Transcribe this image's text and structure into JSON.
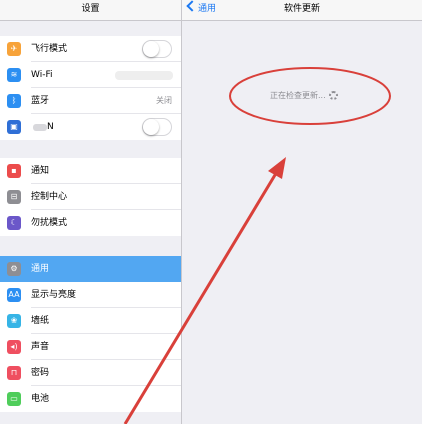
{
  "left_panel": {
    "title": "设置",
    "groups": [
      [
        {
          "label": "飞行模式",
          "icon": "airplane-icon",
          "color": "#f7a33a",
          "glyph": "✈",
          "control": "toggle"
        },
        {
          "label": "Wi-Fi",
          "icon": "wifi-icon",
          "color": "#2c8ff2",
          "glyph": "≋",
          "control": "blurred"
        },
        {
          "label": "蓝牙",
          "icon": "bluetooth-icon",
          "color": "#2c8ff2",
          "glyph": "ᛒ",
          "value": "关闭"
        },
        {
          "label": "N",
          "icon": "vpn-icon",
          "color": "#2f6fd6",
          "glyph": "▣",
          "control": "toggle",
          "blurred_prefix": true
        }
      ],
      [
        {
          "label": "通知",
          "icon": "notification-icon",
          "color": "#ec4c4c",
          "glyph": "▪"
        },
        {
          "label": "控制中心",
          "icon": "control-center-icon",
          "color": "#8e8e93",
          "glyph": "⊟"
        },
        {
          "label": "勿扰模式",
          "icon": "moon-icon",
          "color": "#6b57c9",
          "glyph": "☾"
        }
      ],
      [
        {
          "label": "通用",
          "icon": "gear-icon",
          "color": "#8e8e93",
          "glyph": "⚙",
          "selected": true
        },
        {
          "label": "显示与亮度",
          "icon": "display-icon",
          "color": "#2c8ff2",
          "glyph": "AA"
        },
        {
          "label": "墙纸",
          "icon": "wallpaper-icon",
          "color": "#36b4e6",
          "glyph": "❀"
        },
        {
          "label": "声音",
          "icon": "sound-icon",
          "color": "#ef4f60",
          "glyph": "◂)"
        },
        {
          "label": "密码",
          "icon": "lock-icon",
          "color": "#ef4f60",
          "glyph": "⊓"
        },
        {
          "label": "电池",
          "icon": "battery-icon",
          "color": "#4fcd5b",
          "glyph": "▭"
        }
      ]
    ]
  },
  "right_panel": {
    "back_label": "通用",
    "title": "软件更新",
    "status_text": "正在检查更新..."
  },
  "colors": {
    "accent": "#1d79f2",
    "selected_row": "#52a7f2",
    "annotation": "#d9403a"
  }
}
